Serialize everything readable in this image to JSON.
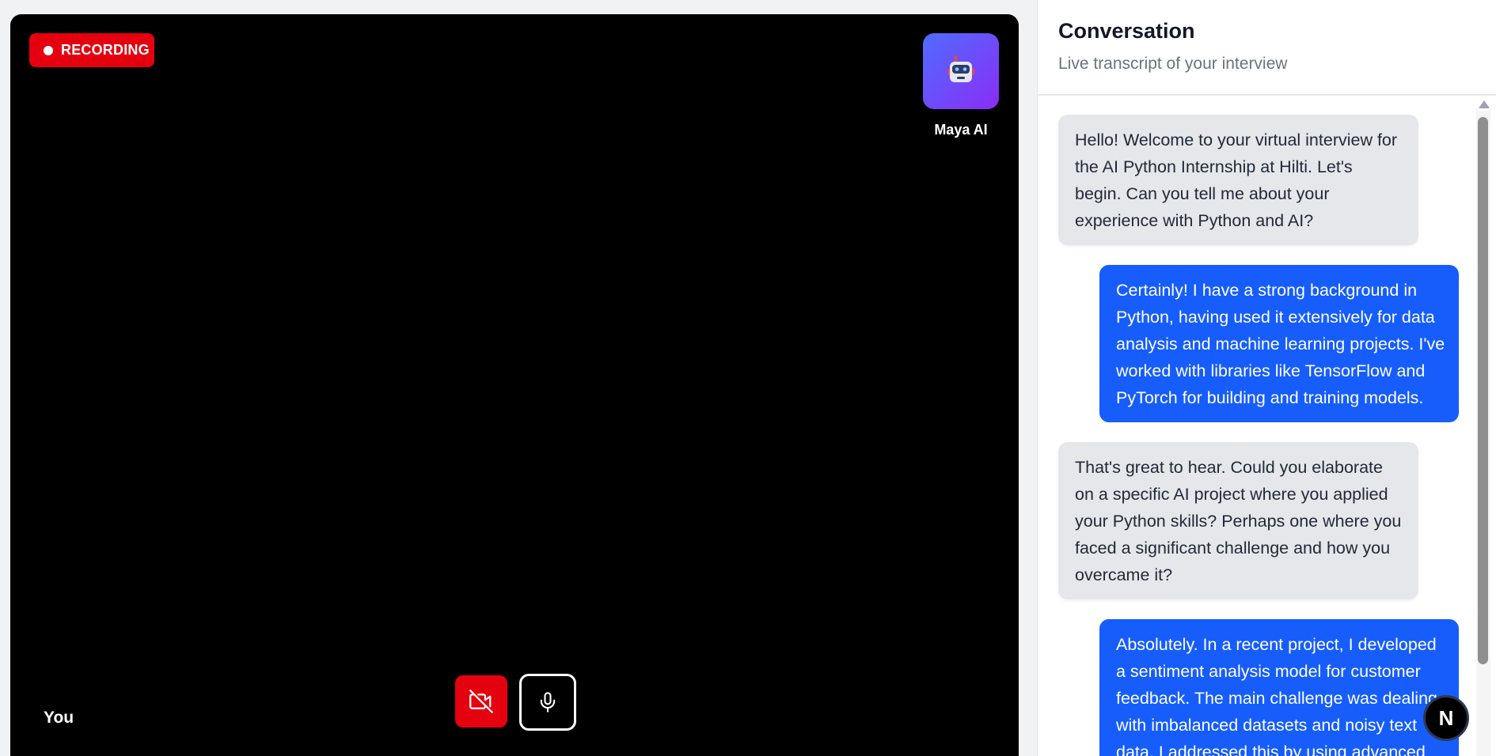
{
  "video": {
    "recording_label": "RECORDING",
    "ai_name": "Maya AI",
    "user_label": "You"
  },
  "controls": {
    "camera_icon": "video-off-icon",
    "mic_icon": "microphone-icon"
  },
  "conversation": {
    "title": "Conversation",
    "subtitle": "Live transcript of your interview",
    "messages": [
      {
        "role": "ai",
        "text": "Hello! Welcome to your virtual interview for the AI Python Internship at Hilti. Let's begin. Can you tell me about your experience with Python and AI?"
      },
      {
        "role": "user",
        "text": "Certainly! I have a strong background in Python, having used it extensively for data analysis and machine learning projects. I've worked with libraries like TensorFlow and PyTorch for building and training models."
      },
      {
        "role": "ai",
        "text": "That's great to hear. Could you elaborate on a specific AI project where you applied your Python skills? Perhaps one where you faced a significant challenge and how you overcame it?"
      },
      {
        "role": "user",
        "text": "Absolutely. In a recent project, I developed a sentiment analysis model for customer feedback. The main challenge was dealing with imbalanced datasets and noisy text data. I addressed this by using advanced"
      }
    ]
  },
  "badge": {
    "letter": "N"
  },
  "colors": {
    "recording": "#e5000f",
    "user_bubble": "#165dfc",
    "ai_bubble": "#e5e7eb",
    "avatar_gradient_start": "#4f6dff",
    "avatar_gradient_end": "#8b2cf5"
  }
}
